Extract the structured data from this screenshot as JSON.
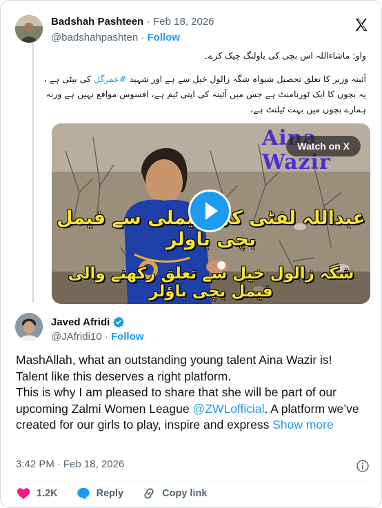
{
  "quoted_tweet": {
    "author_name": "Badshah Pashteen",
    "separator": "·",
    "date": "Feb 18, 2026",
    "handle": "@badshahpashten",
    "follow_label": "Follow",
    "text_line1": "واو: ماشاءاللہ اس بچی کی باولنگ چیک کرے۔",
    "text_line2_pre": "آئینہ وزیر کا تعلق تحصیل شیواہ شگہ زالول خیل سے ہے اور شہید ",
    "hashtag": "#عمرگل",
    "text_line2_post": " کی بیٹی ہے ،",
    "text_line3": "یہ بچوں کا ایک ٹورنامنٹ ہے جس میں آئینہ کی اپنی ٹیم ہے، افسوس مواقع نہیں ہے ورنہ",
    "text_line4": "ہمارے بچوں میں بہت ٹیلنٹ ہے،",
    "video": {
      "watch_label": "Watch on X",
      "overlay_title": "Aina Wazir",
      "caption1": "عبداللہ لفٹی کی فیملی سے فیمل بچی  باولر",
      "caption2": "شگہ زالول خیل سے تعلق رکھنے والی فیمل بچی باؤلر"
    }
  },
  "tweet": {
    "author_name": "Javed Afridi",
    "handle": "@JAfridi10",
    "separator": "·",
    "follow_label": "Follow",
    "text_p1": "MashAllah, what an outstanding young talent Aina Wazir is!",
    "text_p2": "Talent like this deserves a right platform.",
    "text_p3_pre": "This is why I am pleased to share that she will be part of our upcoming Zalmi Women League ",
    "mention": "@ZWLofficial",
    "text_p3_post": ". A platform we’ve created for our girls to play, inspire and express ",
    "show_more": "Show more",
    "time": "3:42 PM",
    "date": "Feb 18, 2026",
    "like_count": "1.2K",
    "reply_label": "Reply",
    "copy_label": "Copy link"
  },
  "colors": {
    "accent": "#1d9bf0",
    "like": "#f91880",
    "secondary_text": "#536471",
    "caption_yellow": "#f7e236"
  },
  "icons": [
    "x-logo-icon",
    "verified-badge-icon",
    "play-icon",
    "info-icon",
    "heart-icon",
    "reply-icon",
    "link-icon"
  ]
}
